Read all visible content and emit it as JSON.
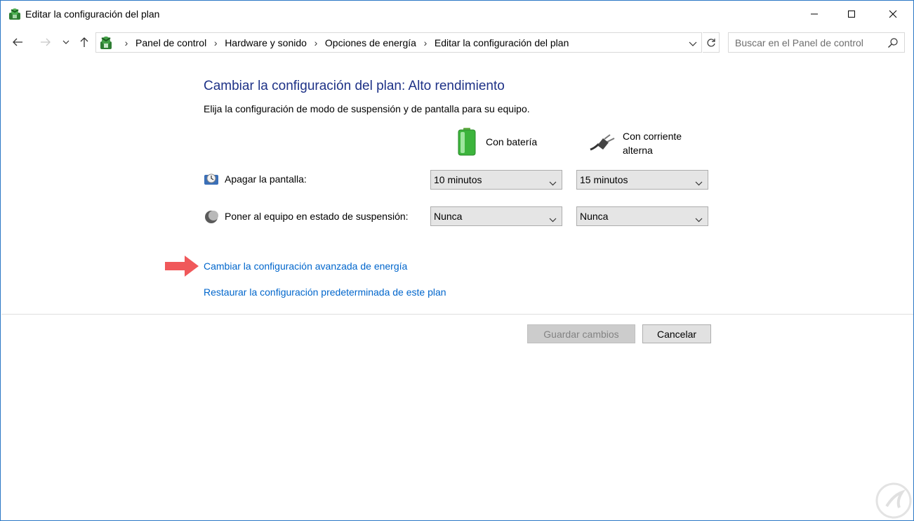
{
  "window": {
    "title": "Editar la configuración del plan"
  },
  "navigation": {
    "breadcrumbs": [
      "Panel de control",
      "Hardware y sonido",
      "Opciones de energía",
      "Editar la configuración del plan"
    ],
    "search_placeholder": "Buscar en el Panel de control"
  },
  "main": {
    "heading": "Cambiar la configuración del plan: Alto rendimiento",
    "description": "Elija la configuración de modo de suspensión y de pantalla para su equipo.",
    "columns": {
      "battery": "Con batería",
      "ac_line1": "Con corriente",
      "ac_line2": "alterna"
    },
    "settings": [
      {
        "label": "Apagar la pantalla:",
        "battery_value": "10 minutos",
        "ac_value": "15 minutos"
      },
      {
        "label": "Poner al equipo en estado de suspensión:",
        "battery_value": "Nunca",
        "ac_value": "Nunca"
      }
    ],
    "links": {
      "advanced": "Cambiar la configuración avanzada de energía",
      "restore": "Restaurar la configuración predeterminada de este plan"
    }
  },
  "footer": {
    "save_label": "Guardar cambios",
    "cancel_label": "Cancelar"
  },
  "colors": {
    "heading": "#1e3287",
    "link": "#0066cc",
    "highlight_arrow": "#f0585a"
  }
}
